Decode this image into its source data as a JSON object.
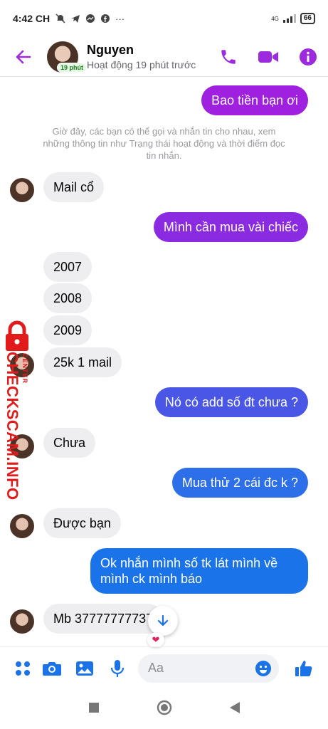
{
  "status_bar": {
    "time": "4:42 CH",
    "network": "4G",
    "battery": "66"
  },
  "header": {
    "name": "Nguyen",
    "active_badge": "19 phút",
    "status": "Hoạt động 19 phút trước",
    "accent_color": "#9d2bdd"
  },
  "messages": [
    {
      "side": "out",
      "text": "Bao tiền bạn ơi",
      "color": "#a020e0"
    },
    {
      "side": "system",
      "text": "Giờ đây, các bạn có thể gọi và nhắn tin cho nhau, xem những thông tin như Trạng thái hoạt động và thời điểm đọc tin nhắn."
    },
    {
      "side": "in",
      "text": "Mail cổ"
    },
    {
      "side": "out",
      "text": "Mình cần mua vài chiếc",
      "color": "#8a2be2"
    },
    {
      "side": "in",
      "text": "2007"
    },
    {
      "side": "in",
      "text": "2008"
    },
    {
      "side": "in",
      "text": "2009"
    },
    {
      "side": "in",
      "text": "25k 1 mail"
    },
    {
      "side": "out",
      "text": "Nó có add số đt chưa ?",
      "color": "#4a56e6"
    },
    {
      "side": "in",
      "text": "Chưa"
    },
    {
      "side": "out",
      "text": "Mua thử 2 cái đc k ?",
      "color": "#2c6fe8"
    },
    {
      "side": "in",
      "text": "Được bạn"
    },
    {
      "side": "out",
      "text": "Ok nhắn mình số tk lát mình về mình ck mình báo",
      "line1": "Ok nhắn mình số tk lát mình về",
      "line2": "mình ck mình báo",
      "color": "#1a73e8"
    },
    {
      "side": "in",
      "text": "Mb 37777777737"
    }
  ],
  "reaction": "❤",
  "composer": {
    "placeholder": "Aa"
  },
  "watermark": {
    "brand": "CHECKSCAM.INFO",
    "sub": "CENTER"
  },
  "icons": [
    "back-arrow-icon",
    "phone-icon",
    "video-icon",
    "info-icon",
    "menu-dots-icon",
    "camera-icon",
    "image-icon",
    "microphone-icon",
    "emoji-icon",
    "like-icon",
    "arrow-down-icon"
  ]
}
